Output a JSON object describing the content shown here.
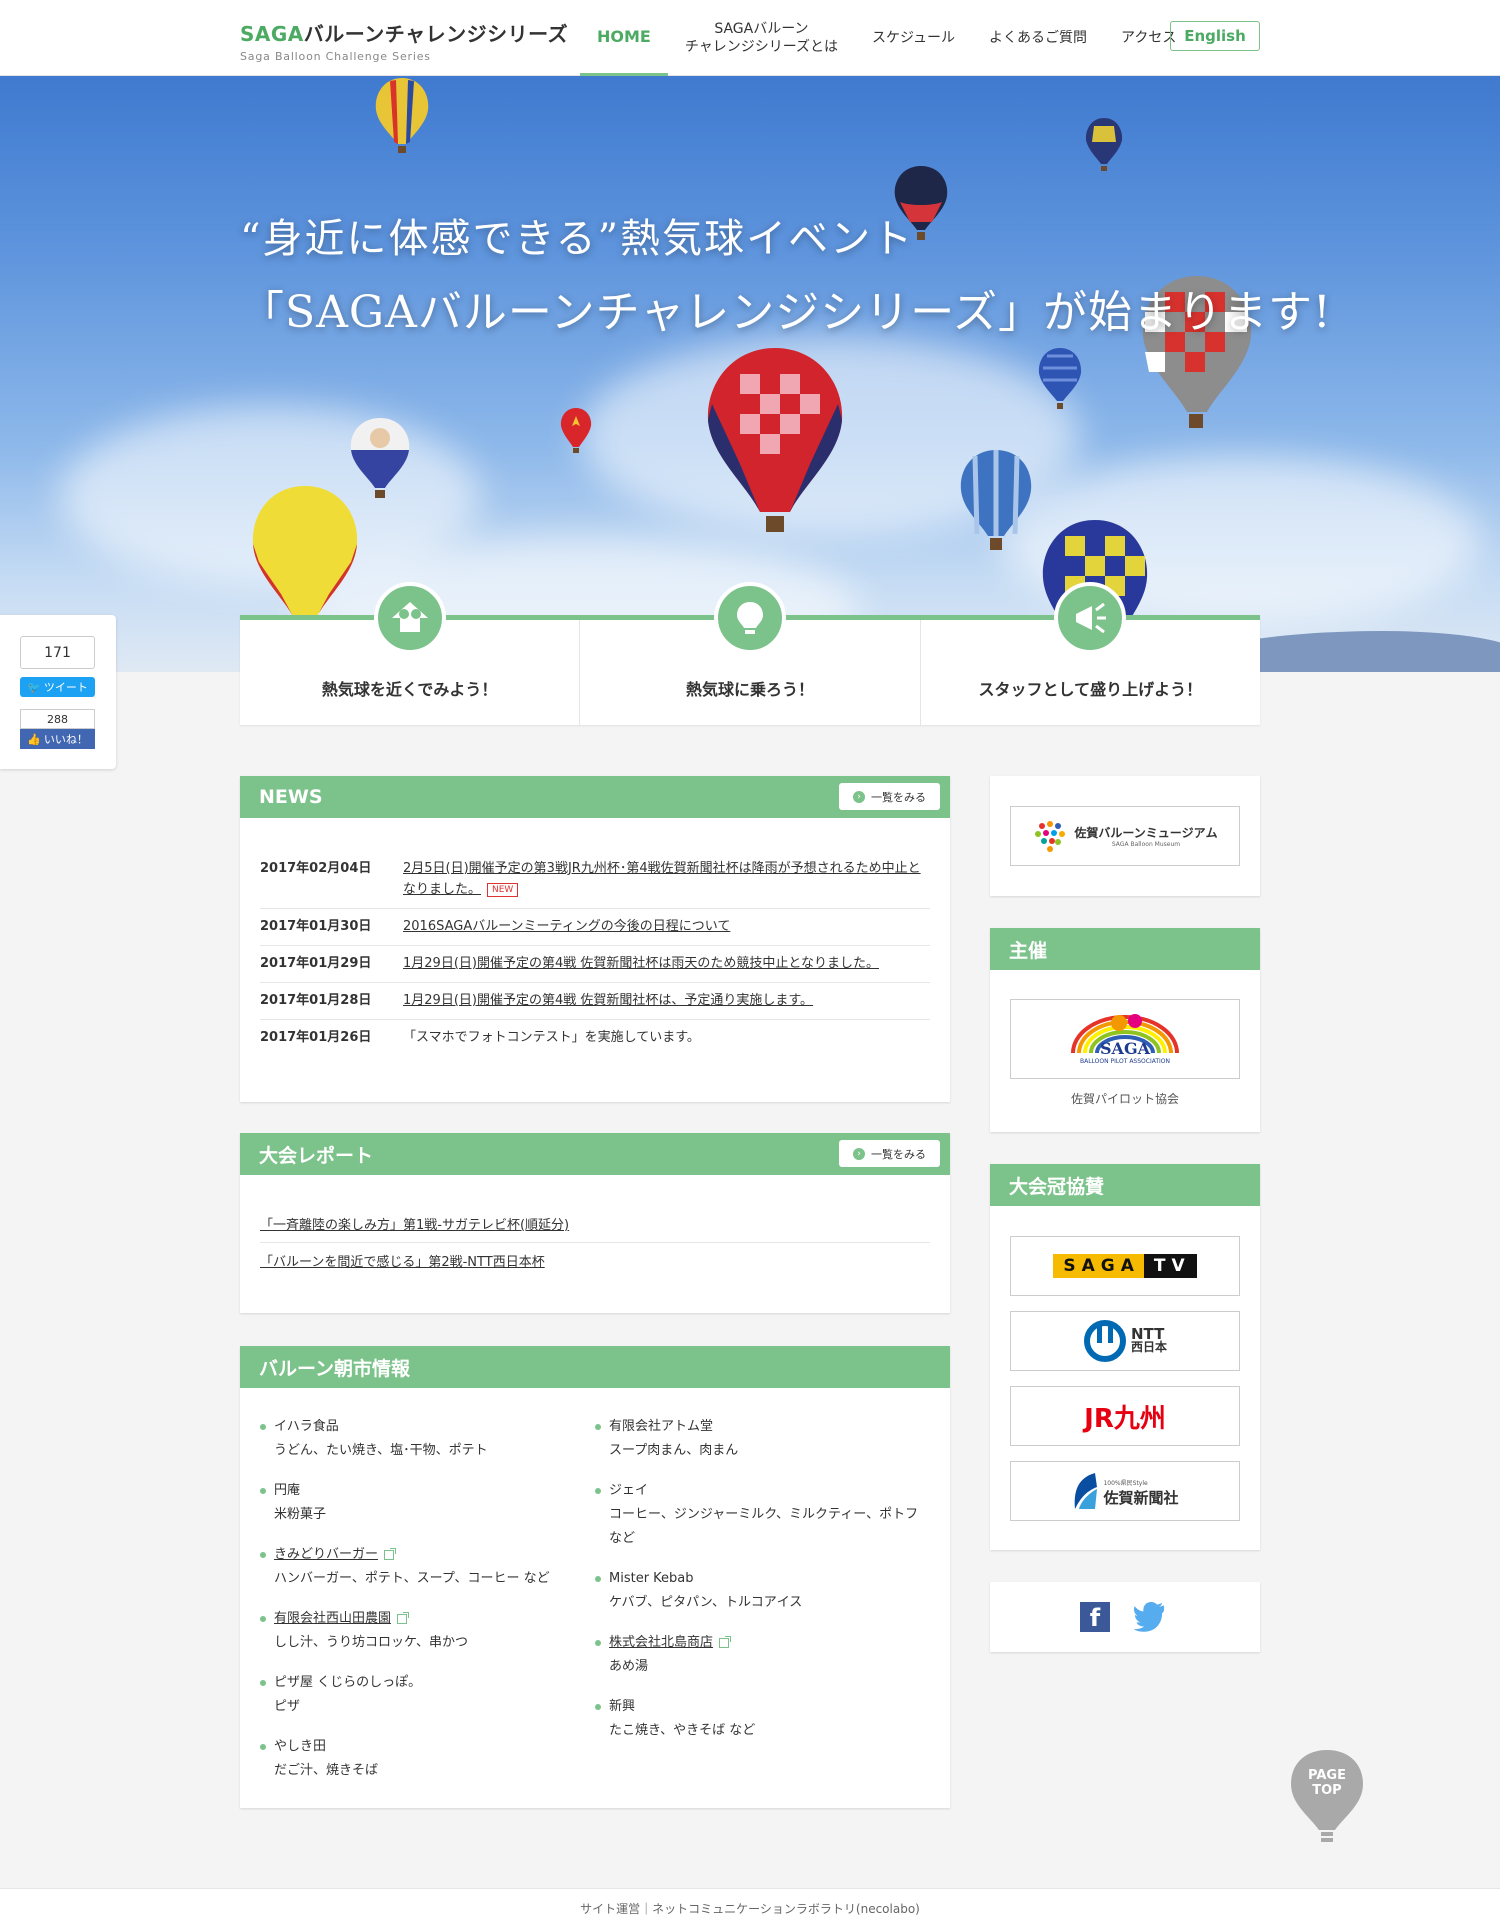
{
  "header": {
    "logo_accent": "SAGA",
    "logo_title": "バルーンチャレンジシリーズ",
    "logo_sub": "Saga Balloon Challenge Series",
    "nav": [
      {
        "label": "HOME"
      },
      {
        "label_line1": "SAGAバルーン",
        "label_line2": "チャレンジシリーズとは"
      },
      {
        "label": "スケジュール"
      },
      {
        "label": "よくあるご質問"
      },
      {
        "label": "アクセス"
      }
    ],
    "english": "English",
    "accent_color": "#7cc28b"
  },
  "hero": {
    "line1": "“身近に体感できる”熱気球イベント",
    "line2": "「SAGAバルーンチャレンジシリーズ」が始まります!"
  },
  "features": [
    {
      "label": "熱気球を近くでみよう！",
      "icon": "binoculars-icon"
    },
    {
      "label": "熱気球に乗ろう！",
      "icon": "lightbulb-icon"
    },
    {
      "label": "スタッフとして盛り上げよう！",
      "icon": "megaphone-icon"
    }
  ],
  "social_share": {
    "tweet_count": "171",
    "tweet_label": "ツイート",
    "like_count": "288",
    "like_label": "いいね！"
  },
  "news": {
    "title": "NEWS",
    "more": "一覧をみる",
    "items": [
      {
        "date": "2017年02月04日",
        "text": "2月5日(日)開催予定の第3戦JR九州杯･第4戦佐賀新聞社杯は降雨が予想されるため中止となりました。",
        "badge": "NEW"
      },
      {
        "date": "2017年01月30日",
        "text": "2016SAGAバルーンミーティングの今後の日程について"
      },
      {
        "date": "2017年01月29日",
        "text": "1月29日(日)開催予定の第4戦 佐賀新聞社杯は雨天のため競技中止となりました。"
      },
      {
        "date": "2017年01月28日",
        "text": "1月29日(日)開催予定の第4戦 佐賀新聞社杯は、予定通り実施します。"
      },
      {
        "date": "2017年01月26日",
        "text": "「スマホでフォトコンテスト」を実施しています。"
      }
    ]
  },
  "reports": {
    "title": "大会レポート",
    "more": "一覧をみる",
    "items": [
      "「一斉離陸の楽しみ方」第1戦-サガテレビ杯(順延分)",
      "「バルーンを間近で感じる」第2戦-NTT西日本杯"
    ]
  },
  "market": {
    "title": "バルーン朝市情報",
    "left": [
      {
        "name": "イハラ食品",
        "desc": "うどん、たい焼き、塩･干物、ポテト",
        "link": false
      },
      {
        "name": "円庵",
        "desc": "米粉菓子",
        "link": false
      },
      {
        "name": "きみどりバーガー",
        "desc": "ハンバーガー、ポテト、スープ、コーヒー など",
        "link": true
      },
      {
        "name": "有限会社西山田農園",
        "desc": "しし汁、うり坊コロッケ、串かつ",
        "link": true
      },
      {
        "name": "ピザ屋 くじらのしっぽ。",
        "desc": "ピザ",
        "link": false
      },
      {
        "name": "やしき田",
        "desc": "だご汁、焼きそば",
        "link": false
      }
    ],
    "right": [
      {
        "name": "有限会社アトム堂",
        "desc": "スープ肉まん、肉まん",
        "link": false
      },
      {
        "name": "ジェイ",
        "desc": "コーヒー、ジンジャーミルク、ミルクティー、ポトフ など",
        "link": false
      },
      {
        "name": "Mister Kebab",
        "desc": "ケバブ、ピタパン、トルコアイス",
        "link": false
      },
      {
        "name": "株式会社北島商店",
        "desc": "あめ湯",
        "link": true
      },
      {
        "name": "新興",
        "desc": "たこ焼き、やきそば など",
        "link": false
      }
    ]
  },
  "sidebar": {
    "museum_label": "佐賀バルーンミュージアム",
    "museum_sub": "SAGA Balloon Museum",
    "organizer_title": "主催",
    "organizer_logo_text": "SAGA",
    "organizer_logo_sub": "BALLOON PILOT ASSOCIATION",
    "organizer_caption": "佐賀パイロット協会",
    "sponsors_title": "大会冠協賛",
    "sponsors": {
      "sagatv_a": "SAGA",
      "sagatv_b": "TV",
      "ntt_a": "NTT",
      "ntt_b": "西日本",
      "jr": "JR九州",
      "newspaper_tag": "100%県民Style",
      "newspaper": "佐賀新聞社"
    }
  },
  "pagetop": {
    "line1": "PAGE",
    "line2": "TOP"
  },
  "footer": {
    "text": "サイト運営｜ネットコミュニケーションラボラトリ(necolabo)"
  }
}
